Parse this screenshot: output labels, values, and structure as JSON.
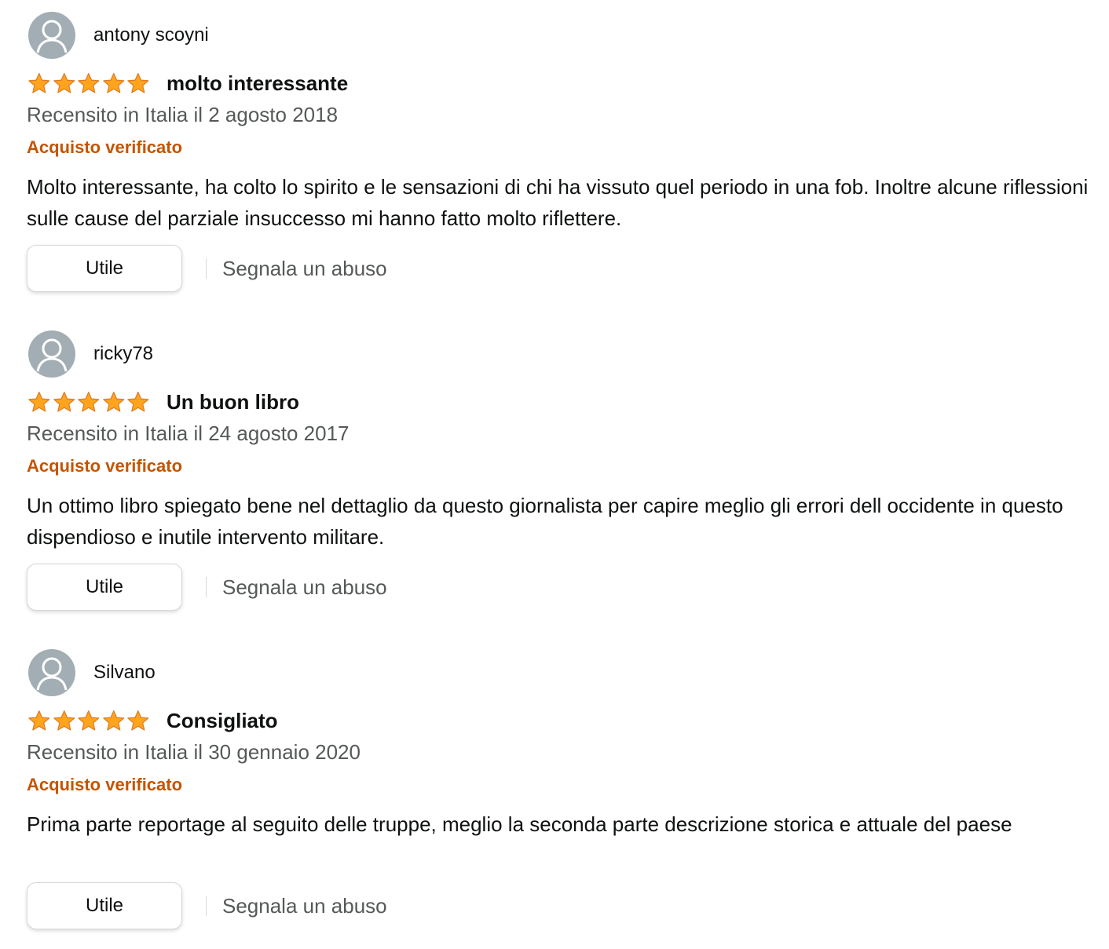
{
  "reviews": [
    {
      "profile_name": "antony scoyni",
      "rating": 5,
      "rating_max": 5,
      "title": "molto interessante",
      "date": "Recensito in Italia il 2 agosto 2018",
      "verified": "Acquisto verificato",
      "body": "Molto interessante, ha colto lo spirito e le sensazioni di chi ha vissuto quel periodo in una fob. Inoltre alcune riflessioni sulle cause del parziale insuccesso mi hanno fatto molto riflettere.",
      "helpful_label": "Utile",
      "report_label": "Segnala un abuso"
    },
    {
      "profile_name": "ricky78",
      "rating": 5,
      "rating_max": 5,
      "title": "Un buon libro",
      "date": "Recensito in Italia il 24 agosto 2017",
      "verified": "Acquisto verificato",
      "body": "Un ottimo libro spiegato bene nel dettaglio da questo giornalista per capire meglio gli errori dell occidente in questo dispendioso e inutile intervento militare.",
      "helpful_label": "Utile",
      "report_label": "Segnala un abuso"
    },
    {
      "profile_name": "Silvano",
      "rating": 5,
      "rating_max": 5,
      "title": "Consigliato",
      "date": "Recensito in Italia il 30 gennaio 2020",
      "verified": "Acquisto verificato",
      "body": "Prima parte reportage al seguito delle truppe, meglio la seconda parte descrizione storica e attuale del paese",
      "helpful_label": "Utile",
      "report_label": "Segnala un abuso"
    }
  ],
  "colors": {
    "star_fill": "#ffa41c",
    "star_outline": "#de7921",
    "verified": "#c45500",
    "avatar_bg": "#a2aeb4"
  },
  "icons": {
    "avatar": "default-user-avatar-icon",
    "star": "star-filled-icon"
  }
}
